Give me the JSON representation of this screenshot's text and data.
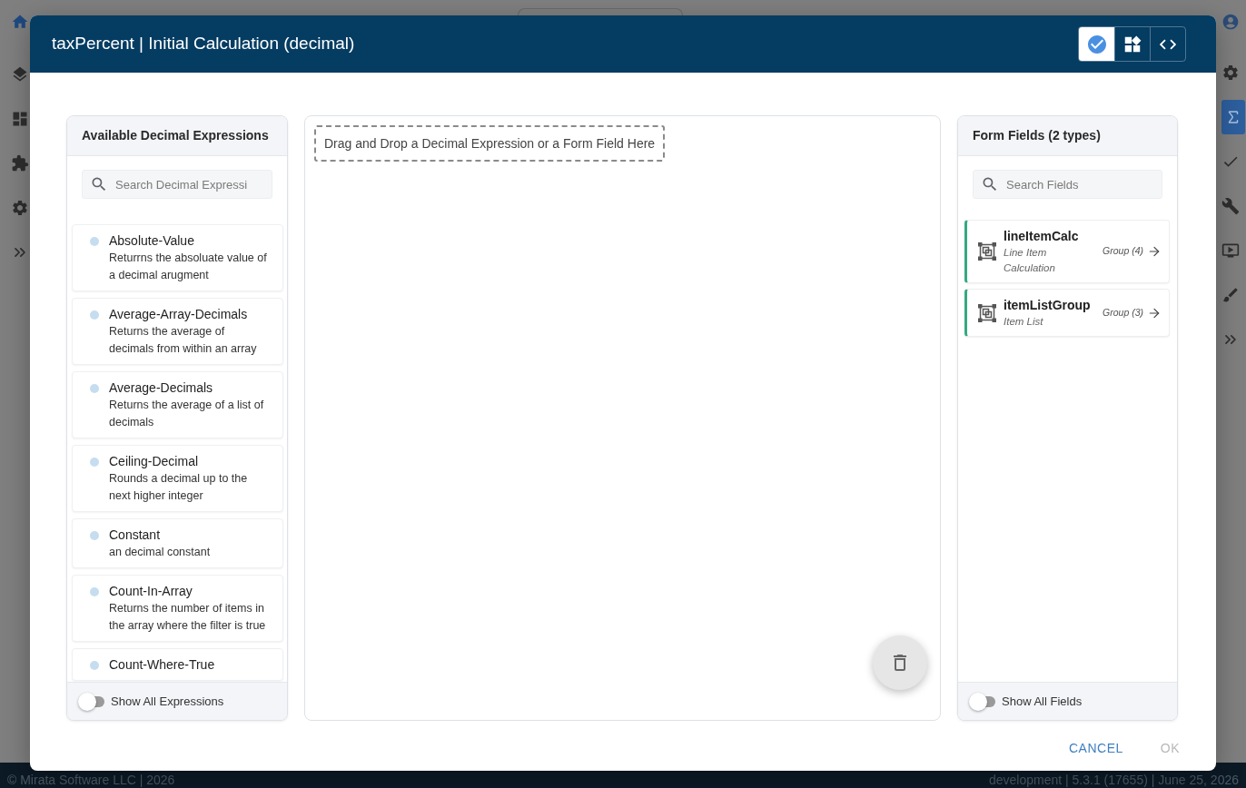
{
  "app": {
    "left_rail": [
      {
        "kind": "home",
        "selected": true
      },
      {
        "kind": "layers",
        "selected": false
      },
      {
        "kind": "dashboard",
        "selected": false
      },
      {
        "kind": "puzzle",
        "selected": false
      },
      {
        "kind": "settings",
        "selected": false
      },
      {
        "kind": "expand",
        "selected": false
      }
    ],
    "right_rail": [
      {
        "kind": "user",
        "selected": false
      },
      {
        "kind": "settings",
        "selected": false
      },
      {
        "kind": "sigma",
        "selected": true
      },
      {
        "kind": "check",
        "selected": false
      },
      {
        "kind": "wrench",
        "selected": false
      },
      {
        "kind": "monitor",
        "selected": false
      },
      {
        "kind": "brush",
        "selected": false
      },
      {
        "kind": "expand",
        "selected": false
      }
    ],
    "footer": {
      "copyright": "© Mirata Software LLC | 2026",
      "version": "development | 5.3.1 (17655) | June 25, 2026"
    }
  },
  "dialog": {
    "title": "taxPercent | Initial Calculation (decimal)",
    "view_buttons": [
      {
        "kind": "check",
        "selected": true
      },
      {
        "kind": "widgets",
        "selected": false
      },
      {
        "kind": "code",
        "selected": false
      }
    ],
    "expressions_panel": {
      "title": "Available Decimal Expressions",
      "search": {
        "placeholder": "Search Decimal Expressi"
      },
      "items": [
        {
          "name": "Absolute-Value",
          "description": "Returrns the absoluate value of a decimal arugment"
        },
        {
          "name": "Average-Array-Decimals",
          "description": "Returns the average of decimals from within an array"
        },
        {
          "name": "Average-Decimals",
          "description": "Returns the average of a list of decimals"
        },
        {
          "name": "Ceiling-Decimal",
          "description": "Rounds a decimal up to the next higher integer"
        },
        {
          "name": "Constant",
          "description": "an decimal constant"
        },
        {
          "name": "Count-In-Array",
          "description": "Returns the number of items in the array where the filter is true"
        },
        {
          "name": "Count-Where-True"
        }
      ],
      "toggle": {
        "label": "Show All Expressions",
        "on": false
      }
    },
    "canvas": {
      "drop_hint": "Drag and Drop a Decimal Expression or a Form Field Here"
    },
    "fields_panel": {
      "title": "Form Fields (2 types)",
      "search": {
        "placeholder": "Search Fields"
      },
      "items": [
        {
          "name": "lineItemCalc",
          "label": "Line Item Calculation",
          "type": "Group (4)"
        },
        {
          "name": "itemListGroup",
          "label": "Item List",
          "type": "Group (3)"
        }
      ],
      "toggle": {
        "label": "Show All Fields",
        "on": false
      }
    },
    "actions": [
      {
        "label": "CANCEL",
        "disabled": false
      },
      {
        "label": "OK",
        "disabled": true
      }
    ]
  }
}
